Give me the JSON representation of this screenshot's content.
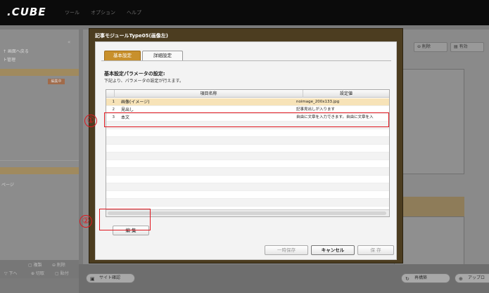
{
  "app": {
    "logo": ".CUBE",
    "menu": [
      "ツール",
      "オプション",
      "ヘルプ"
    ]
  },
  "left_panel": {
    "collapse": "«",
    "items": [
      "↑ 画面へ戻る",
      "ト管理"
    ],
    "badge": "編集中",
    "page_label": "ページ",
    "bottom_actions": [
      "▢ 複製",
      "⊖ 削除",
      "▽ 下へ",
      "⊕ 切取",
      "▢ 貼付"
    ]
  },
  "right_toolbar": {
    "delete": "⊖ 削除",
    "valid": "▤ 有効"
  },
  "bottom_bar": {
    "site_check": "サイト確認",
    "rebuild": "再構築",
    "upload": "アップロ"
  },
  "dialog": {
    "title": "記事モジュールType05(画像左)",
    "tabs": [
      "基本設定",
      "詳細設定"
    ],
    "section_title": "基本設定パラメータの設定:",
    "section_desc": "下記より、パラメータの設定が行えます。",
    "grid": {
      "headers": {
        "item": "項目名称",
        "value": "設定値"
      },
      "rows": [
        {
          "num": "1",
          "item": "画像(イメージ)",
          "value": "noimage_200x133.jpg"
        },
        {
          "num": "2",
          "item": "見出し",
          "value": "記事見出しが入ります"
        },
        {
          "num": "3",
          "item": "本文",
          "value": "自由に文章を入力できます。自由に文章を入"
        }
      ]
    },
    "buttons": {
      "edit": "編 集",
      "temp_save": "一時保存",
      "cancel": "キャンセル",
      "save": "保 存"
    }
  },
  "annotations": {
    "callout1": "①",
    "callout2": "②"
  },
  "colors": {
    "accent": "#c8902c",
    "annotation_red": "#e0171f",
    "selected_row": "#f7e3b8"
  }
}
